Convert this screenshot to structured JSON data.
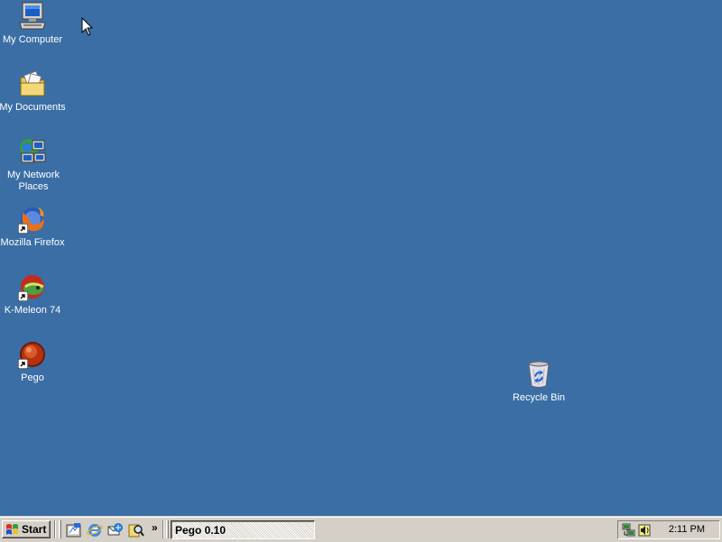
{
  "desktop": {
    "background": "#3a6ea5",
    "icons": [
      {
        "label": "My Computer",
        "icon": "my-computer-icon",
        "shortcut": false
      },
      {
        "label": "My Documents",
        "icon": "my-documents-icon",
        "shortcut": false
      },
      {
        "label": "My Network Places",
        "icon": "my-network-places-icon",
        "shortcut": false
      },
      {
        "label": "Mozilla Firefox",
        "icon": "firefox-icon",
        "shortcut": true
      },
      {
        "label": "K-Meleon 74",
        "icon": "k-meleon-icon",
        "shortcut": true
      },
      {
        "label": "Pego",
        "icon": "pego-icon",
        "shortcut": true
      }
    ],
    "recycle_bin": {
      "label": "Recycle Bin",
      "icon": "recycle-bin-icon"
    }
  },
  "taskbar": {
    "start_label": "Start",
    "quick_launch": [
      "show-desktop-icon",
      "internet-explorer-icon",
      "outlook-express-icon",
      "search-icon"
    ],
    "more_label": "»",
    "tasks": [
      {
        "label": "Pego 0.10",
        "active": true
      }
    ],
    "tray": {
      "icons": [
        "network-icon",
        "volume-icon"
      ],
      "clock": "2:11 PM"
    }
  }
}
